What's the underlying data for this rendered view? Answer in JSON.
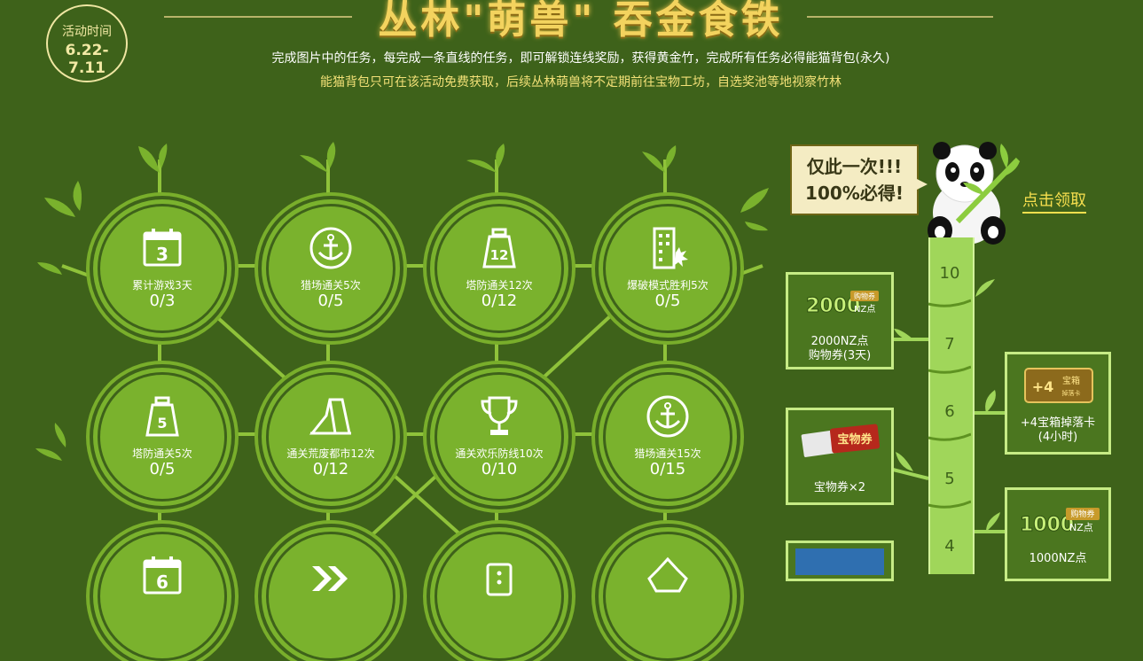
{
  "header": {
    "title": "丛林\"萌兽\" 吞金食铁",
    "date_label": "活动时间",
    "date_range": "6.22-7.11",
    "desc_line1": "完成图片中的任务，每完成一条直线的任务，即可解锁连线奖励，获得黄金竹，完成所有任务必得能猫背包(永久)",
    "desc_line2": "能猫背包只可在该活动免费获取，后续丛林萌兽将不定期前往宝物工坊，自选奖池等地视察竹林"
  },
  "tasks": [
    {
      "label": "累计游戏3天",
      "progress": "0/3",
      "icon": "calendar-icon",
      "badge": "3"
    },
    {
      "label": "猎场通关5次",
      "progress": "0/5",
      "icon": "anchor-icon",
      "badge": ""
    },
    {
      "label": "塔防通关12次",
      "progress": "0/12",
      "icon": "weight-icon",
      "badge": "12"
    },
    {
      "label": "爆破模式胜利5次",
      "progress": "0/5",
      "icon": "building-icon",
      "badge": ""
    },
    {
      "label": "塔防通关5次",
      "progress": "0/5",
      "icon": "weight-icon",
      "badge": "5"
    },
    {
      "label": "通关荒废都市12次",
      "progress": "0/12",
      "icon": "ruins-icon",
      "badge": ""
    },
    {
      "label": "通关欢乐防线10次",
      "progress": "0/10",
      "icon": "trophy-icon",
      "badge": ""
    },
    {
      "label": "猎场通关15次",
      "progress": "0/15",
      "icon": "anchor-icon",
      "badge": ""
    },
    {
      "label": "",
      "progress": "",
      "icon": "calendar-icon",
      "badge": "6"
    },
    {
      "label": "",
      "progress": "",
      "icon": "chevrons-icon",
      "badge": ""
    },
    {
      "label": "",
      "progress": "",
      "icon": "dice-icon",
      "badge": ""
    },
    {
      "label": "",
      "progress": "",
      "icon": "crown-icon",
      "badge": ""
    }
  ],
  "promo": {
    "bubble_line1": "仅此一次!!!",
    "bubble_line2": "100%必得!",
    "claim_label": "点击领取"
  },
  "levels": [
    "10",
    "7",
    "6",
    "5",
    "4"
  ],
  "rewards": {
    "r7": {
      "art_text": "2000",
      "art_unit": "NZ点",
      "art_tag": "购物券",
      "label1": "2000NZ点",
      "label2": "购物券(3天)"
    },
    "r6": {
      "art_text": "+4",
      "art_unit": "宝箱",
      "art_tag": "掉落卡",
      "label1": "+4宝箱掉落卡",
      "label2": "(4小时)"
    },
    "r5": {
      "art_text": "宝物券",
      "label1": "宝物券×2"
    },
    "r4": {
      "art_text": "1000",
      "art_unit": "NZ点",
      "art_tag": "购物券",
      "label1": "1000NZ点"
    }
  },
  "colors": {
    "bg": "#3e621a",
    "node": "#7ab22d",
    "gold": "#f3d35e",
    "stalk": "#a0d65a"
  }
}
